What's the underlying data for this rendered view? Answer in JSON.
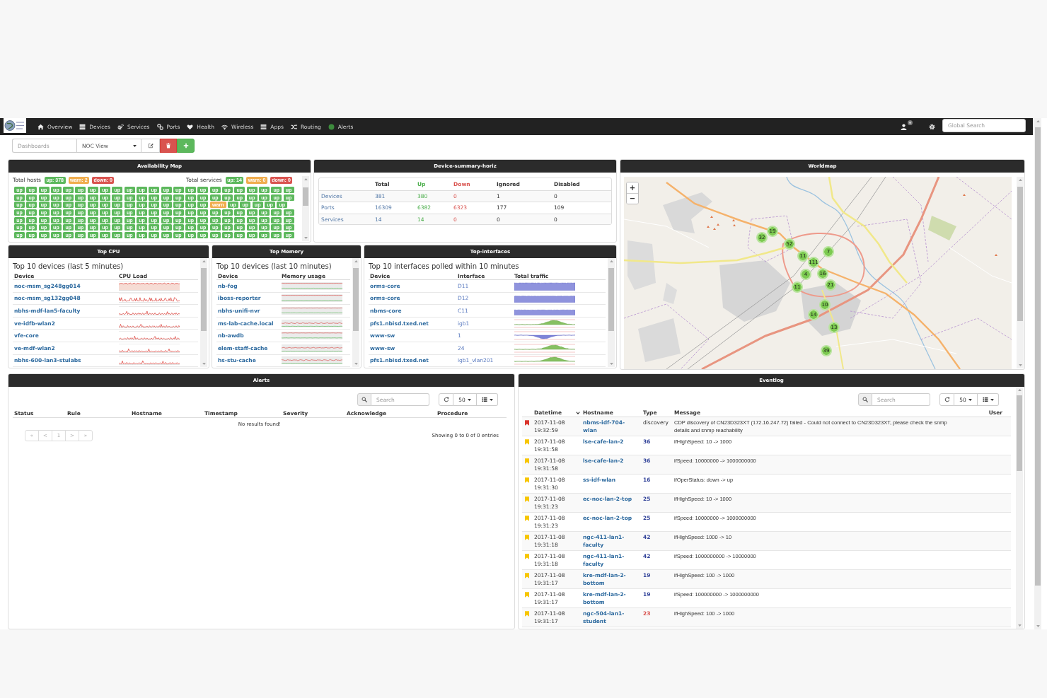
{
  "navbar": {
    "items": [
      {
        "label": "Overview",
        "kind": "home"
      },
      {
        "label": "Devices",
        "kind": "devices"
      },
      {
        "label": "Services",
        "kind": "services"
      },
      {
        "label": "Ports",
        "kind": "ports"
      },
      {
        "label": "Health",
        "kind": "health"
      },
      {
        "label": "Wireless",
        "kind": "wireless"
      },
      {
        "label": "Apps",
        "kind": "apps"
      },
      {
        "label": "Routing",
        "kind": "routing"
      },
      {
        "label": "Alerts",
        "kind": "alerts"
      }
    ],
    "global_search": {
      "placeholder": "Global Search"
    }
  },
  "dashboard_bar": {
    "label": "Dashboards",
    "selected_dashboard": "NOC View"
  },
  "availability_map": {
    "title": "Availability Map",
    "groups": [
      {
        "label": "Total hosts",
        "badges": [
          {
            "label": "up: 378",
            "kind": "up"
          },
          {
            "label": "warn: 2",
            "kind": "warn"
          },
          {
            "label": "down: 0",
            "kind": "down"
          }
        ]
      },
      {
        "label": "Total services",
        "badges": [
          {
            "label": "up: 14",
            "kind": "up"
          },
          {
            "label": "warn: 0",
            "kind": "warn"
          },
          {
            "label": "down: 0",
            "kind": "down"
          }
        ]
      }
    ],
    "tiles": [
      {
        "label": "up",
        "kind": "up"
      },
      {
        "label": "up",
        "kind": "up"
      },
      {
        "label": "up",
        "kind": "up"
      },
      {
        "label": "up",
        "kind": "up"
      },
      {
        "label": "up",
        "kind": "up"
      },
      {
        "label": "up",
        "kind": "up"
      },
      {
        "label": "up",
        "kind": "up"
      },
      {
        "label": "up",
        "kind": "up"
      },
      {
        "label": "up",
        "kind": "up"
      },
      {
        "label": "up",
        "kind": "up"
      },
      {
        "label": "up",
        "kind": "up"
      },
      {
        "label": "up",
        "kind": "up"
      },
      {
        "label": "up",
        "kind": "up"
      },
      {
        "label": "up",
        "kind": "up"
      },
      {
        "label": "up",
        "kind": "up"
      },
      {
        "label": "up",
        "kind": "up"
      },
      {
        "label": "up",
        "kind": "up"
      },
      {
        "label": "up",
        "kind": "up"
      },
      {
        "label": "up",
        "kind": "up"
      },
      {
        "label": "up",
        "kind": "up"
      },
      {
        "label": "up",
        "kind": "up"
      },
      {
        "label": "up",
        "kind": "up"
      },
      {
        "label": "up",
        "kind": "up"
      },
      {
        "label": "up",
        "kind": "up"
      },
      {
        "label": "up",
        "kind": "up"
      },
      {
        "label": "up",
        "kind": "up"
      },
      {
        "label": "up",
        "kind": "up"
      },
      {
        "label": "up",
        "kind": "up"
      },
      {
        "label": "up",
        "kind": "up"
      },
      {
        "label": "up",
        "kind": "up"
      },
      {
        "label": "up",
        "kind": "up"
      },
      {
        "label": "up",
        "kind": "up"
      },
      {
        "label": "up",
        "kind": "up"
      },
      {
        "label": "up",
        "kind": "up"
      },
      {
        "label": "up",
        "kind": "up"
      },
      {
        "label": "up",
        "kind": "up"
      },
      {
        "label": "up",
        "kind": "up"
      },
      {
        "label": "up",
        "kind": "up"
      },
      {
        "label": "up",
        "kind": "up"
      },
      {
        "label": "up",
        "kind": "up"
      },
      {
        "label": "up",
        "kind": "up"
      },
      {
        "label": "up",
        "kind": "up"
      },
      {
        "label": "up",
        "kind": "up"
      },
      {
        "label": "up",
        "kind": "up"
      },
      {
        "label": "up",
        "kind": "up"
      },
      {
        "label": "up",
        "kind": "up"
      },
      {
        "label": "up",
        "kind": "up"
      },
      {
        "label": "up",
        "kind": "up"
      },
      {
        "label": "up",
        "kind": "up"
      },
      {
        "label": "up",
        "kind": "up"
      },
      {
        "label": "up",
        "kind": "up"
      },
      {
        "label": "up",
        "kind": "up"
      },
      {
        "label": "up",
        "kind": "up"
      },
      {
        "label": "up",
        "kind": "up"
      },
      {
        "label": "up",
        "kind": "up"
      },
      {
        "label": "up",
        "kind": "up"
      },
      {
        "label": "up",
        "kind": "up"
      },
      {
        "label": "up",
        "kind": "up"
      },
      {
        "label": "up",
        "kind": "up"
      },
      {
        "label": "up",
        "kind": "up"
      },
      {
        "label": "up",
        "kind": "up"
      },
      {
        "label": "up",
        "kind": "up"
      },
      {
        "label": "warn",
        "kind": "warn"
      },
      {
        "label": "up",
        "kind": "up"
      },
      {
        "label": "up",
        "kind": "up"
      },
      {
        "label": "up",
        "kind": "up"
      },
      {
        "label": "up",
        "kind": "up"
      },
      {
        "label": "up",
        "kind": "up"
      },
      {
        "label": "up",
        "kind": "up"
      },
      {
        "label": "up",
        "kind": "up"
      },
      {
        "label": "up",
        "kind": "up"
      },
      {
        "label": "up",
        "kind": "up"
      },
      {
        "label": "up",
        "kind": "up"
      },
      {
        "label": "up",
        "kind": "up"
      },
      {
        "label": "up",
        "kind": "up"
      },
      {
        "label": "up",
        "kind": "up"
      },
      {
        "label": "up",
        "kind": "up"
      },
      {
        "label": "up",
        "kind": "up"
      },
      {
        "label": "up",
        "kind": "up"
      },
      {
        "label": "up",
        "kind": "up"
      },
      {
        "label": "up",
        "kind": "up"
      },
      {
        "label": "up",
        "kind": "up"
      },
      {
        "label": "up",
        "kind": "up"
      },
      {
        "label": "up",
        "kind": "up"
      },
      {
        "label": "up",
        "kind": "up"
      },
      {
        "label": "up",
        "kind": "up"
      },
      {
        "label": "up",
        "kind": "up"
      },
      {
        "label": "up",
        "kind": "up"
      },
      {
        "label": "up",
        "kind": "up"
      },
      {
        "label": "up",
        "kind": "up"
      },
      {
        "label": "up",
        "kind": "up"
      },
      {
        "label": "up",
        "kind": "up"
      },
      {
        "label": "up",
        "kind": "up"
      },
      {
        "label": "up",
        "kind": "up"
      },
      {
        "label": "up",
        "kind": "up"
      },
      {
        "label": "up",
        "kind": "up"
      },
      {
        "label": "up",
        "kind": "up"
      },
      {
        "label": "up",
        "kind": "up"
      },
      {
        "label": "up",
        "kind": "up"
      },
      {
        "label": "up",
        "kind": "up"
      },
      {
        "label": "up",
        "kind": "up"
      },
      {
        "label": "up",
        "kind": "up"
      },
      {
        "label": "up",
        "kind": "up"
      },
      {
        "label": "up",
        "kind": "up"
      },
      {
        "label": "up",
        "kind": "up"
      },
      {
        "label": "up",
        "kind": "up"
      },
      {
        "label": "up",
        "kind": "up"
      },
      {
        "label": "up",
        "kind": "up"
      },
      {
        "label": "up",
        "kind": "up"
      },
      {
        "label": "up",
        "kind": "up"
      },
      {
        "label": "up",
        "kind": "up"
      },
      {
        "label": "up",
        "kind": "up"
      },
      {
        "label": "up",
        "kind": "up"
      },
      {
        "label": "up",
        "kind": "up"
      },
      {
        "label": "up",
        "kind": "up"
      },
      {
        "label": "up",
        "kind": "up"
      },
      {
        "label": "up",
        "kind": "up"
      },
      {
        "label": "up",
        "kind": "up"
      },
      {
        "label": "up",
        "kind": "up"
      },
      {
        "label": "up",
        "kind": "up"
      },
      {
        "label": "up",
        "kind": "up"
      },
      {
        "label": "up",
        "kind": "up"
      },
      {
        "label": "up",
        "kind": "up"
      },
      {
        "label": "up",
        "kind": "up"
      },
      {
        "label": "up",
        "kind": "up"
      },
      {
        "label": "up",
        "kind": "up"
      },
      {
        "label": "up",
        "kind": "up"
      },
      {
        "label": "up",
        "kind": "up"
      },
      {
        "label": "up",
        "kind": "up"
      },
      {
        "label": "up",
        "kind": "up"
      },
      {
        "label": "up",
        "kind": "up"
      },
      {
        "label": "up",
        "kind": "up"
      },
      {
        "label": "up",
        "kind": "up"
      },
      {
        "label": "up",
        "kind": "up"
      },
      {
        "label": "up",
        "kind": "up"
      },
      {
        "label": "up",
        "kind": "up"
      },
      {
        "label": "up",
        "kind": "up"
      },
      {
        "label": "up",
        "kind": "up"
      },
      {
        "label": "up",
        "kind": "up"
      },
      {
        "label": "up",
        "kind": "up"
      },
      {
        "label": "up",
        "kind": "up"
      },
      {
        "label": "up",
        "kind": "up"
      },
      {
        "label": "up",
        "kind": "up"
      },
      {
        "label": "up",
        "kind": "up"
      },
      {
        "label": "up",
        "kind": "up"
      },
      {
        "label": "up",
        "kind": "up"
      },
      {
        "label": "up",
        "kind": "up"
      },
      {
        "label": "up",
        "kind": "up"
      },
      {
        "label": "up",
        "kind": "up"
      },
      {
        "label": "up",
        "kind": "up"
      },
      {
        "label": "up",
        "kind": "up"
      },
      {
        "label": "up",
        "kind": "up"
      },
      {
        "label": "up",
        "kind": "up"
      },
      {
        "label": "up",
        "kind": "up"
      },
      {
        "label": "up",
        "kind": "up"
      },
      {
        "label": "up",
        "kind": "up"
      },
      {
        "label": "up",
        "kind": "up"
      },
      {
        "label": "up",
        "kind": "up"
      },
      {
        "label": "up",
        "kind": "up"
      },
      {
        "label": "up",
        "kind": "up"
      }
    ]
  },
  "device_summary": {
    "title": "Device-summary-horiz",
    "columns": [
      {
        "label": "Total",
        "kind": "total"
      },
      {
        "label": "Up",
        "kind": "up"
      },
      {
        "label": "Down",
        "kind": "down"
      },
      {
        "label": "Ignored",
        "kind": "plain"
      },
      {
        "label": "Disabled",
        "kind": "plain"
      }
    ],
    "rows": [
      {
        "label": "Devices",
        "cells": [
          "381",
          "380",
          "0",
          "1",
          "0"
        ]
      },
      {
        "label": "Ports",
        "cells": [
          "16309",
          "6382",
          "6323",
          "177",
          "109"
        ]
      },
      {
        "label": "Services",
        "cells": [
          "14",
          "14",
          "0",
          "0",
          "0"
        ]
      }
    ]
  },
  "worldmap": {
    "title": "Worldmap",
    "zoom_in": "+",
    "zoom_out": "−",
    "clusters": [
      {
        "count": "19"
      },
      {
        "count": "32"
      },
      {
        "count": "52"
      },
      {
        "count": "11"
      },
      {
        "count": "7"
      },
      {
        "count": "111"
      },
      {
        "count": "4"
      },
      {
        "count": "16"
      },
      {
        "count": "21"
      },
      {
        "count": "11"
      },
      {
        "count": "10"
      },
      {
        "count": "14"
      },
      {
        "count": "13"
      },
      {
        "count": "39"
      }
    ]
  },
  "top_cpu": {
    "title": "Top CPU",
    "subtitle": "Top 10 devices (last 5 minutes)",
    "columns": [
      "Device",
      "CPU Load"
    ],
    "rows": [
      {
        "device": "noc-msm_sg248gg014"
      },
      {
        "device": "noc-msm_sg132gg048"
      },
      {
        "device": "nbhs-mdf-lan5-faculty"
      },
      {
        "device": "ve-idfb-wlan2"
      },
      {
        "device": "vfe-core"
      },
      {
        "device": "ve-mdf-wlan2"
      },
      {
        "device": "nbhs-600-lan3-stulabs"
      }
    ]
  },
  "top_memory": {
    "title": "Top Memory",
    "subtitle": "Top 10 devices (last 10 minutes)",
    "columns": [
      "Device",
      "Memory usage"
    ],
    "rows": [
      {
        "device": "nb-fog"
      },
      {
        "device": "iboss-reporter"
      },
      {
        "device": "nbhs-unifi-nvr"
      },
      {
        "device": "ms-lab-cache.local"
      },
      {
        "device": "nb-awdb"
      },
      {
        "device": "elem-staff-cache"
      },
      {
        "device": "hs-stu-cache"
      }
    ]
  },
  "top_interfaces": {
    "title": "Top-interfaces",
    "subtitle": "Top 10 interfaces polled within 10 minutes",
    "columns": [
      "Device",
      "Interface",
      "Total traffic"
    ],
    "rows": [
      {
        "device": "orms-core",
        "interface": "D11",
        "kind": "saturated"
      },
      {
        "device": "orms-core",
        "interface": "D12",
        "kind": "saturated"
      },
      {
        "device": "nbms-core",
        "interface": "C11",
        "kind": "saturated"
      },
      {
        "device": "pfs1.nbisd.txed.net",
        "interface": "igb1",
        "kind": "peak"
      },
      {
        "device": "www-sw",
        "interface": "1",
        "kind": "dip"
      },
      {
        "device": "www-sw",
        "interface": "24",
        "kind": "peak"
      },
      {
        "device": "pfs1.nbisd.txed.net",
        "interface": "igb1_vlan201",
        "kind": "peak"
      }
    ]
  },
  "alerts": {
    "title": "Alerts",
    "search": {
      "placeholder": "Search"
    },
    "page_size": "50",
    "columns": [
      "Status",
      "Rule",
      "Hostname",
      "Timestamp",
      "Severity",
      "Acknowledge",
      "Procedure"
    ],
    "empty_message": "No results found!",
    "pagination": [
      {
        "label": "«",
        "disabled": true
      },
      {
        "label": "<",
        "disabled": true
      },
      {
        "label": "1",
        "disabled": true
      },
      {
        "label": ">",
        "disabled": true
      },
      {
        "label": "»",
        "disabled": true
      }
    ],
    "info": "Showing 0 to 0 of 0 entries"
  },
  "eventlog": {
    "title": "Eventlog",
    "search": {
      "placeholder": "Search"
    },
    "page_size": "50",
    "columns": [
      {
        "label": "Datetime",
        "sorted": true
      },
      {
        "label": "Hostname",
        "sorted": false
      },
      {
        "label": "Type",
        "sorted": false
      },
      {
        "label": "Message",
        "sorted": false
      },
      {
        "label": "User",
        "sorted": false
      }
    ],
    "rows": [
      {
        "color": "#d9342b",
        "datetime": "2017-11-08 19:32:59",
        "hostname": "nbms-idf-704-wlan",
        "type": {
          "label": "discovery",
          "kind": "text"
        },
        "message": "CDP discovery of CN23D323XT (172.16.247.72) failed - Could not connect to CN23D323XT, please check the snmp details and snmp reachability"
      },
      {
        "color": "#f7c600",
        "datetime": "2017-11-08 19:31:58",
        "hostname": "lse-cafe-lan-2",
        "type": {
          "label": "36",
          "kind": "port"
        },
        "message": "ifHighSpeed: 10 -> 1000"
      },
      {
        "color": "#f7c600",
        "datetime": "2017-11-08 19:31:58",
        "hostname": "lse-cafe-lan-2",
        "type": {
          "label": "36",
          "kind": "port"
        },
        "message": "ifSpeed: 10000000 -> 1000000000"
      },
      {
        "color": "#f7c600",
        "datetime": "2017-11-08 19:31:30",
        "hostname": "ss-idf-wlan",
        "type": {
          "label": "16",
          "kind": "port"
        },
        "message": "ifOperStatus: down -> up"
      },
      {
        "color": "#f7c600",
        "datetime": "2017-11-08 19:31:23",
        "hostname": "ec-noc-lan-2-top",
        "type": {
          "label": "25",
          "kind": "port"
        },
        "message": "ifHighSpeed: 10 -> 1000"
      },
      {
        "color": "#f7c600",
        "datetime": "2017-11-08 19:31:23",
        "hostname": "ec-noc-lan-2-top",
        "type": {
          "label": "25",
          "kind": "port"
        },
        "message": "ifSpeed: 10000000 -> 1000000000"
      },
      {
        "color": "#f7c600",
        "datetime": "2017-11-08 19:31:18",
        "hostname": "ngc-411-lan1-faculty",
        "type": {
          "label": "42",
          "kind": "port"
        },
        "message": "ifHighSpeed: 1000 -> 10"
      },
      {
        "color": "#f7c600",
        "datetime": "2017-11-08 19:31:18",
        "hostname": "ngc-411-lan1-faculty",
        "type": {
          "label": "42",
          "kind": "port"
        },
        "message": "ifSpeed: 1000000000 -> 10000000"
      },
      {
        "color": "#f7c600",
        "datetime": "2017-11-08 19:31:17",
        "hostname": "kre-mdf-lan-2-bottom",
        "type": {
          "label": "19",
          "kind": "port"
        },
        "message": "ifHighSpeed: 100 -> 1000"
      },
      {
        "color": "#f7c600",
        "datetime": "2017-11-08 19:31:17",
        "hostname": "kre-mdf-lan-2-bottom",
        "type": {
          "label": "19",
          "kind": "port"
        },
        "message": "ifSpeed: 100000000 -> 1000000000"
      },
      {
        "color": "#f7c600",
        "datetime": "2017-11-08 19:31:17",
        "hostname": "ngc-504-lan1-student",
        "type": {
          "label": "23",
          "kind": "port-down"
        },
        "message": "ifHighSpeed: 100 -> 1000"
      }
    ]
  }
}
